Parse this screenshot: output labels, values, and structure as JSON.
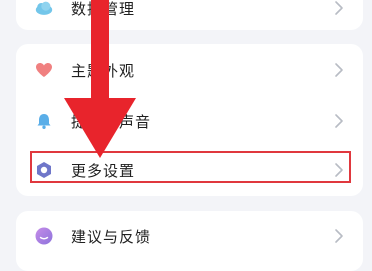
{
  "colors": {
    "page_bg": "#f3f4f8",
    "card_bg": "#ffffff",
    "highlight_border": "#e0383e",
    "arrow": "#e8242c",
    "chevron": "#b8bcc4"
  },
  "settings": {
    "rows": [
      {
        "label": "数据管理",
        "icon": "cloud-icon",
        "icon_color": "#73c6ea"
      },
      {
        "label": "主题外观",
        "icon": "heart-icon",
        "icon_color": "#f08080"
      },
      {
        "label": "提示与声音",
        "icon": "bell-icon",
        "icon_color": "#5aaee8"
      },
      {
        "label": "更多设置",
        "icon": "hexagon-gear-icon",
        "icon_color": "#6f76c9"
      },
      {
        "label": "建议与反馈",
        "icon": "feedback-icon",
        "icon_color": "#a07be0"
      }
    ]
  }
}
